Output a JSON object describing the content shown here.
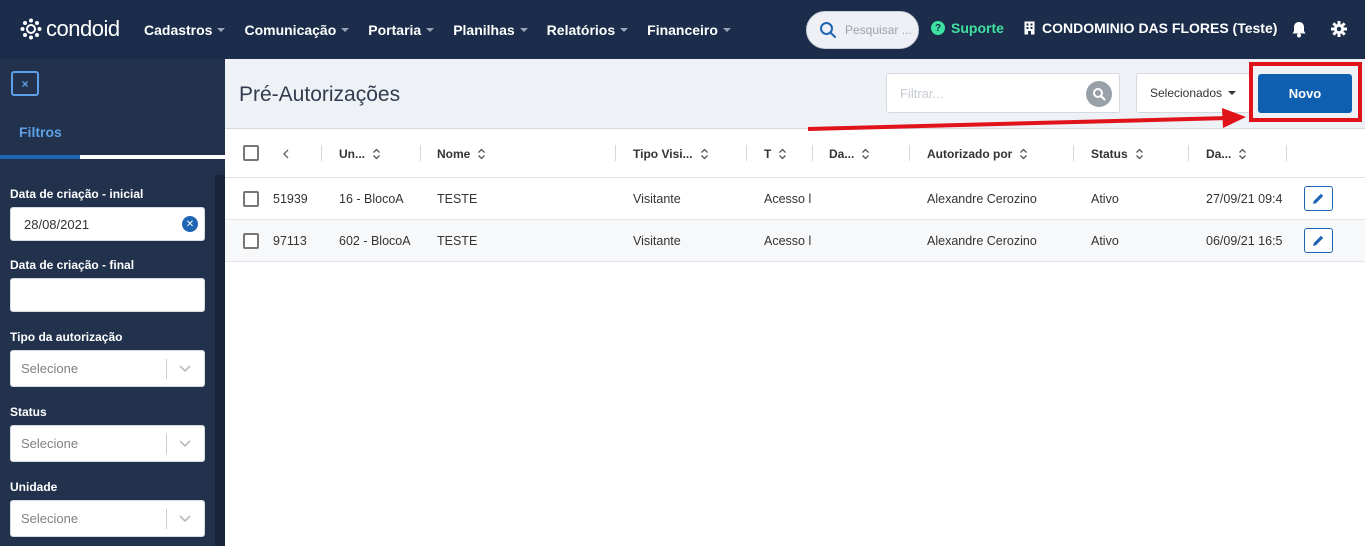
{
  "app": {
    "logo_text": "condoid",
    "nav": [
      "Cadastros",
      "Comunicação",
      "Portaria",
      "Planilhas",
      "Relatórios",
      "Financeiro"
    ],
    "search_placeholder": "Pesquisar ...",
    "support_label": "Suporte",
    "condo_name": "CONDOMINIO DAS FLORES (Teste)"
  },
  "sidebar": {
    "close_label": "×",
    "tab_label": "Filtros",
    "fields": {
      "created_start_label": "Data de criação - inicial",
      "created_start_value": "28/08/2021",
      "created_end_label": "Data de criação - final",
      "created_end_value": "",
      "auth_type_label": "Tipo da autorização",
      "auth_type_value": "Selecione",
      "status_label": "Status",
      "status_value": "Selecione",
      "unit_label": "Unidade",
      "unit_value": "Selecione"
    }
  },
  "main": {
    "title": "Pré-Autorizações",
    "filter_placeholder": "Filtrar...",
    "selected_label": "Selecionados",
    "new_label": "Novo"
  },
  "table": {
    "columns": [
      "Un...",
      "Nome",
      "Tipo Visi...",
      "T",
      "Da...",
      "Autorizado por",
      "Status",
      "Da..."
    ],
    "rows": [
      {
        "id": "51939",
        "unit": "16 - BlocoA",
        "name": "TESTE",
        "visit_type": "Visitante",
        "t": "Acesso l",
        "da": "",
        "authorized_by": "Alexandre Cerozino",
        "status": "Ativo",
        "date": "27/09/21 09:4"
      },
      {
        "id": "97113",
        "unit": "602 - BlocoA",
        "name": "TESTE",
        "visit_type": "Visitante",
        "t": "Acesso l",
        "da": "",
        "authorized_by": "Alexandre Cerozino",
        "status": "Ativo",
        "date": "06/09/21 16:5"
      }
    ]
  },
  "colors": {
    "topbar": "#1b2d4a",
    "sidebar": "#22324d",
    "primary": "#0f5fb0",
    "support": "#3fe1a0",
    "annotation": "#e0121a"
  }
}
